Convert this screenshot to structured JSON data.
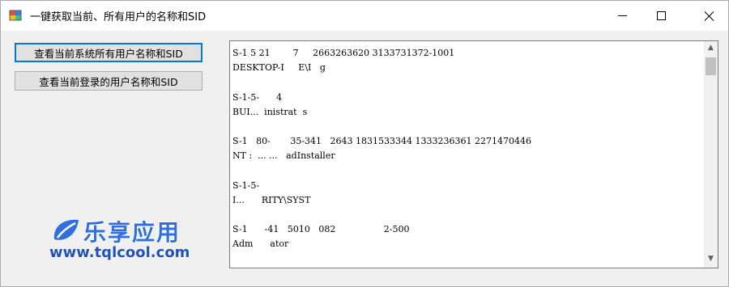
{
  "window": {
    "title": "一键获取当前、所有用户的名称和SID"
  },
  "buttons": {
    "list_all_users": "查看当前系统所有用户名称和SID",
    "current_user": "查看当前登录的用户名称和SID"
  },
  "output": {
    "lines": [
      "S-1 5 21        7     2663263620 3133731372-1001",
      "DESKTOP-I     E\\I   g",
      "",
      "S-1-5-      4",
      "BUI...  inistrat  s",
      "",
      "S-1   80-       35-341   2643 1831533344 1333236361 2271470446",
      "NT :  ... ...   adInstaller",
      "",
      "S-1-5-",
      "I...      RITY\\SYST",
      "",
      "S-1      -41   5010   082                 2-500",
      "Adm      ator",
      ""
    ]
  },
  "watermark": {
    "name": "乐享应用",
    "url": "www.tqlcool.com"
  }
}
